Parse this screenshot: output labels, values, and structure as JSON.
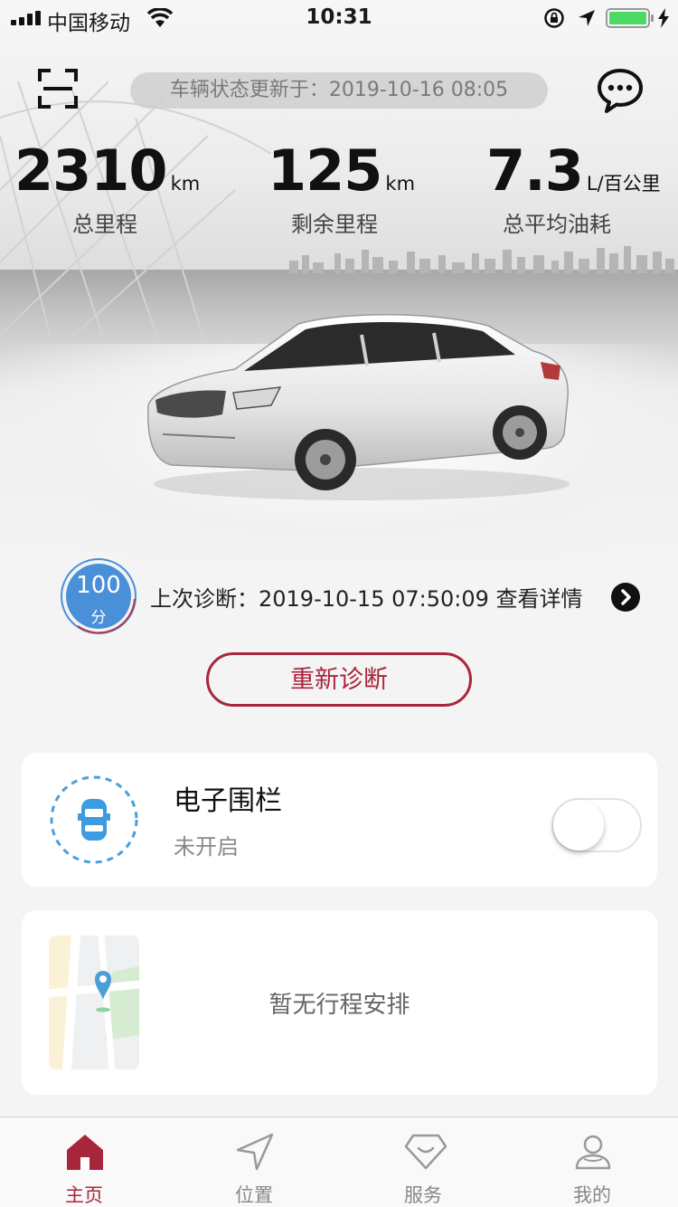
{
  "status_bar": {
    "carrier": "中国移动",
    "time": "10:31"
  },
  "header": {
    "update_text": "车辆状态更新于：2019-10-16 08:05"
  },
  "stats": [
    {
      "value": "2310",
      "unit": "km",
      "label": "总里程"
    },
    {
      "value": "125",
      "unit": "km",
      "label": "剩余里程"
    },
    {
      "value": "7.3",
      "unit": "L/百公里",
      "label": "总平均油耗"
    }
  ],
  "diagnosis": {
    "score": "100",
    "score_unit": "分",
    "last_text": "上次诊断：2019-10-15 07:50:09 查看详情",
    "rediagnose_label": "重新诊断"
  },
  "geofence": {
    "title": "电子围栏",
    "status": "未开启",
    "enabled": false
  },
  "trip": {
    "empty_text": "暂无行程安排"
  },
  "tabs": [
    {
      "label": "主页",
      "icon": "home-icon",
      "active": true
    },
    {
      "label": "位置",
      "icon": "navigation-icon",
      "active": false
    },
    {
      "label": "服务",
      "icon": "service-icon",
      "active": false
    },
    {
      "label": "我的",
      "icon": "profile-icon",
      "active": false
    }
  ],
  "colors": {
    "accent": "#a8263b",
    "score_blue": "#4a90d9"
  }
}
